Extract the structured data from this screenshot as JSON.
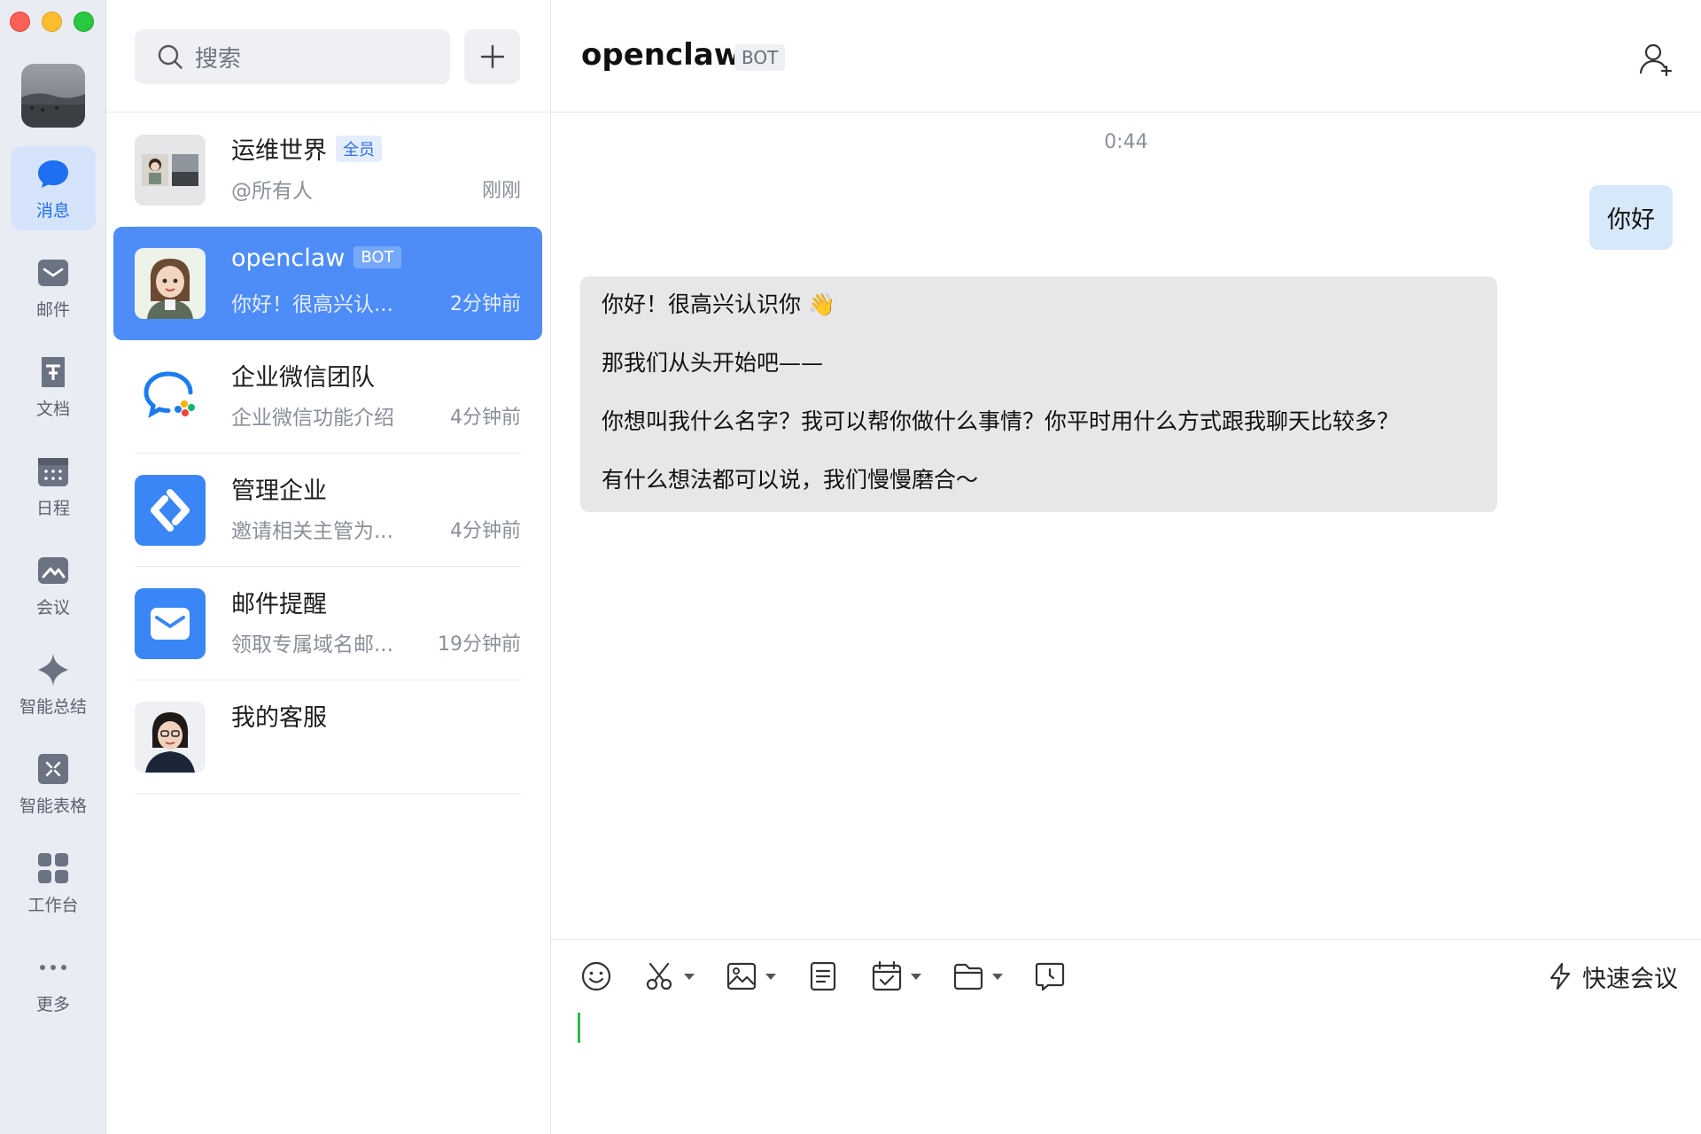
{
  "sidebar": {
    "items": [
      {
        "label": "消息",
        "icon": "chat-bubble-icon",
        "active": true
      },
      {
        "label": "邮件",
        "icon": "mail-icon",
        "active": false
      },
      {
        "label": "文档",
        "icon": "document-icon",
        "active": false
      },
      {
        "label": "日程",
        "icon": "calendar-icon",
        "active": false
      },
      {
        "label": "会议",
        "icon": "meeting-icon",
        "active": false
      },
      {
        "label": "智能总结",
        "icon": "sparkle-icon",
        "active": false
      },
      {
        "label": "智能表格",
        "icon": "smart-sheet-icon",
        "active": false
      },
      {
        "label": "工作台",
        "icon": "grid-icon",
        "active": false
      },
      {
        "label": "更多",
        "icon": "more-icon",
        "active": false
      }
    ]
  },
  "search": {
    "placeholder": "搜索"
  },
  "conversations": [
    {
      "name": "运维世界",
      "tag": "全员",
      "preview": "@所有人",
      "time": "刚刚"
    },
    {
      "name": "openclaw",
      "tag": "BOT",
      "preview": "你好！很高兴认...",
      "time": "2分钟前",
      "selected": true
    },
    {
      "name": "企业微信团队",
      "tag": "",
      "preview": "企业微信功能介绍",
      "time": "4分钟前"
    },
    {
      "name": "管理企业",
      "tag": "",
      "preview": "邀请相关主管为...",
      "time": "4分钟前"
    },
    {
      "name": "邮件提醒",
      "tag": "",
      "preview": "领取专属域名邮...",
      "time": "19分钟前"
    },
    {
      "name": "我的客服",
      "tag": "",
      "preview": "",
      "time": ""
    }
  ],
  "chat": {
    "title": "openclaw",
    "title_tag": "BOT",
    "timestamp": "0:44",
    "outgoing": "你好",
    "incoming": [
      "你好！很高兴认识你 👋",
      "那我们从头开始吧——",
      "你想叫我什么名字？我可以帮你做什么事情？你平时用什么方式跟我聊天比较多？",
      "有什么想法都可以说，我们慢慢磨合～"
    ]
  },
  "composer": {
    "quick_meeting": "快速会议"
  },
  "colors": {
    "accent": "#1e6ff1",
    "selected_row": "#4e8df8",
    "outgoing_bubble": "#d7e8fa",
    "incoming_bubble": "#e7e7e9"
  }
}
